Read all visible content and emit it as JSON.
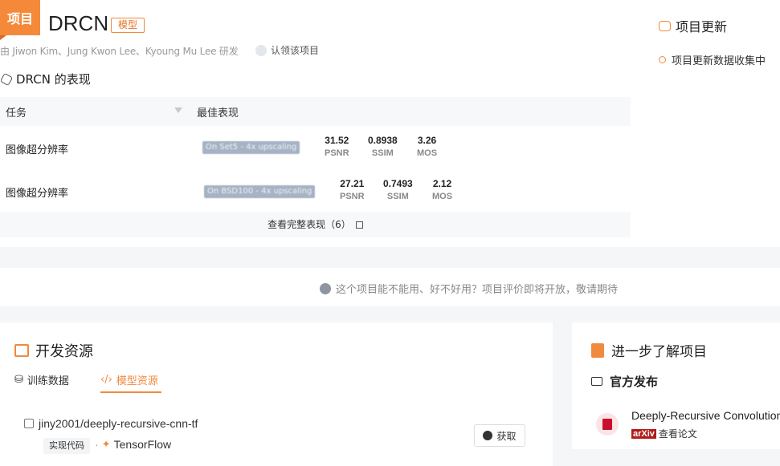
{
  "header": {
    "badge": "项目",
    "title": "DRCN",
    "tag": "模型",
    "authors": "由 Jiwon Kim、Jung Kwon Lee、Kyoung Mu Lee 研发",
    "claim": "认领该项目"
  },
  "performance": {
    "title": "DRCN 的表现",
    "col_task": "任务",
    "col_best": "最佳表现",
    "rows": [
      {
        "task": "图像超分辨率",
        "dataset": "On Set5 - 4x upscaling",
        "metrics": [
          {
            "value": "31.52",
            "name": "PSNR"
          },
          {
            "value": "0.8938",
            "name": "SSIM"
          },
          {
            "value": "3.26",
            "name": "MOS"
          }
        ]
      },
      {
        "task": "图像超分辨率",
        "dataset": "On BSD100 - 4x upscaling",
        "metrics": [
          {
            "value": "27.21",
            "name": "PSNR"
          },
          {
            "value": "0.7493",
            "name": "SSIM"
          },
          {
            "value": "2.12",
            "name": "MOS"
          }
        ]
      }
    ],
    "more": "查看完整表现（6）"
  },
  "updates": {
    "title": "项目更新",
    "item": "项目更新数据收集中"
  },
  "review": {
    "text": "这个项目能不能用、好不好用？项目评价即将开放，敬请期待"
  },
  "dev_resources": {
    "title": "开发资源",
    "tab_data": "训练数据",
    "tab_model": "模型资源",
    "repo": "jiny2001/deeply-recursive-cnn-tf",
    "impl_tag": "实现代码",
    "framework": "TensorFlow",
    "get_label": "获取"
  },
  "learn_more": {
    "title": "进一步了解项目",
    "official": "官方发布",
    "paper_title": "Deeply-Recursive Convolutional Network for Image Super-Resolution",
    "arxiv": "arXiv",
    "view_paper": "查看论文"
  },
  "colors": {
    "accent": "#f08a3c",
    "badge": "#f4893a",
    "arxiv": "#b31b1b"
  }
}
